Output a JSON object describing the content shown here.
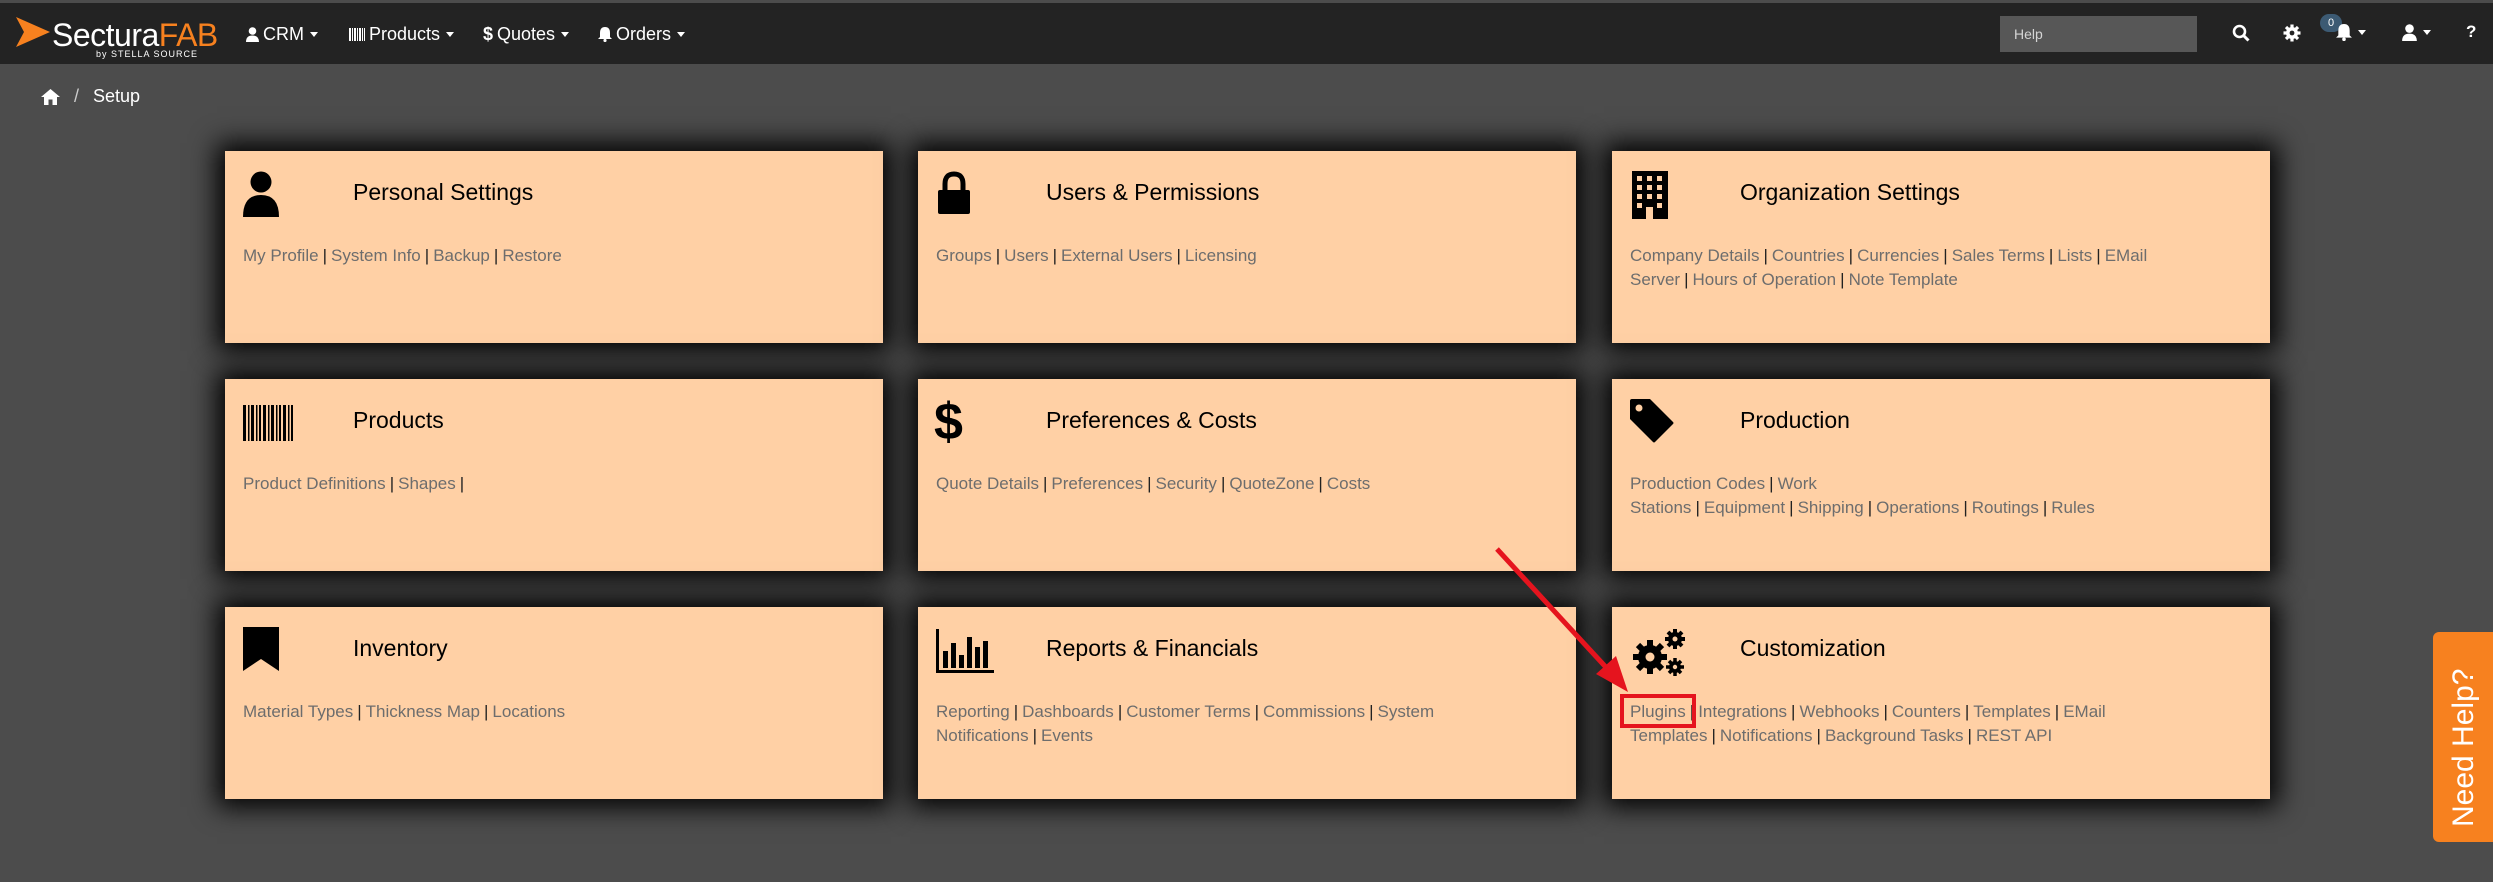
{
  "header": {
    "logo_main": "Sectura",
    "logo_accent": "FAB",
    "logo_sub": "by STELLA SOURCE",
    "nav": [
      {
        "label": "CRM",
        "icon": "user-icon"
      },
      {
        "label": "Products",
        "icon": "barcode-icon"
      },
      {
        "label": "Quotes",
        "icon": "dollar-icon"
      },
      {
        "label": "Orders",
        "icon": "bell-icon"
      }
    ],
    "search_placeholder": "Help",
    "notifications_count": "0",
    "help_glyph": "?"
  },
  "breadcrumb": {
    "home_icon": "home-icon",
    "current": "Setup"
  },
  "cards": [
    {
      "title": "Personal Settings",
      "icon": "user-icon",
      "links": [
        "My Profile",
        "System Info",
        "Backup",
        "Restore"
      ]
    },
    {
      "title": "Users & Permissions",
      "icon": "lock-icon",
      "links": [
        "Groups",
        "Users",
        "External Users",
        "Licensing"
      ]
    },
    {
      "title": "Organization Settings",
      "icon": "building-icon",
      "links": [
        "Company Details",
        "Countries",
        "Currencies",
        "Sales Terms",
        "Lists",
        "EMail Server",
        "Hours of Operation",
        "Note Template"
      ]
    },
    {
      "title": "Products",
      "icon": "barcode-icon",
      "links": [
        "Product Definitions",
        "Shapes"
      ]
    },
    {
      "title": "Preferences & Costs",
      "icon": "dollar-icon",
      "links": [
        "Quote Details",
        "Preferences",
        "Security",
        "QuoteZone",
        "Costs"
      ]
    },
    {
      "title": "Production",
      "icon": "tag-icon",
      "links": [
        "Production Codes",
        "Work Stations",
        "Equipment",
        "Shipping",
        "Operations",
        "Routings",
        "Rules"
      ]
    },
    {
      "title": "Inventory",
      "icon": "bookmark-icon",
      "links": [
        "Material Types",
        "Thickness Map",
        "Locations"
      ]
    },
    {
      "title": "Reports & Financials",
      "icon": "bar-chart-icon",
      "links": [
        "Reporting",
        "Dashboards",
        "Customer Terms",
        "Commissions",
        "System Notifications",
        "Events"
      ]
    },
    {
      "title": "Customization",
      "icon": "gears-icon",
      "links": [
        "Plugins",
        "Integrations",
        "Webhooks",
        "Counters",
        "Templates",
        "EMail Templates",
        "Notifications",
        "Background Tasks",
        "REST API"
      ]
    }
  ],
  "need_help": "Need Help?",
  "colors": {
    "accent": "#f7811f",
    "card_bg": "#ffd0a5",
    "topbar_bg": "#232323",
    "page_bg": "#4c4c4c",
    "annotation": "#e5141e"
  }
}
